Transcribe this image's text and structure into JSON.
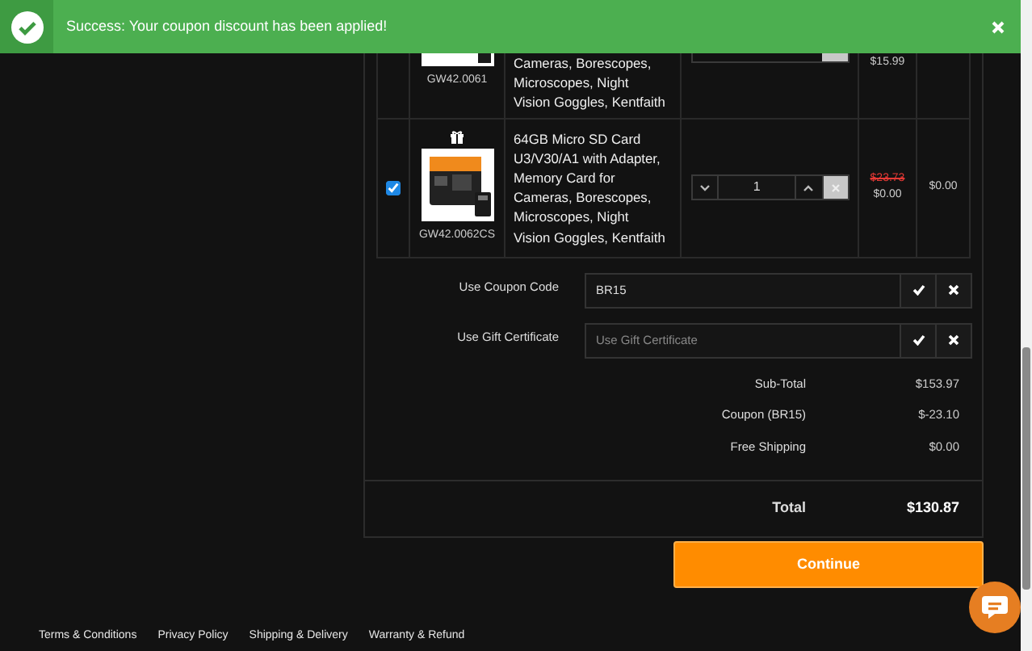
{
  "alert": {
    "message": "Success: Your coupon discount has been applied!"
  },
  "cart": {
    "rows": [
      {
        "kind": "partial",
        "code": "GW42.0061",
        "description": "Cameras, Borescopes, Microscopes, Night Vision Goggles, Kentfaith",
        "price": "$15.99"
      },
      {
        "kind": "full",
        "selected": true,
        "gift": true,
        "code": "GW42.0062CS",
        "description": "64GB Micro SD Card U3/V30/A1 with Adapter, Memory Card for Cameras, Borescopes, Microscopes, Night Vision Goggles, Kentfaith",
        "quantity": "1",
        "old_price": "$23.73",
        "price": "$0.00",
        "total": "$0.00"
      }
    ]
  },
  "codes": [
    {
      "label": "Use Coupon Code",
      "value": "BR15"
    },
    {
      "label": "Use Gift Certificate",
      "placeholder": "Use Gift Certificate"
    }
  ],
  "totals": [
    {
      "label": "Sub-Total",
      "value": "$153.97"
    },
    {
      "label": "Coupon (BR15)",
      "value": "$-23.10"
    },
    {
      "label": "Free Shipping",
      "value": "$0.00"
    }
  ],
  "grand_total": {
    "label": "Total",
    "value": "$130.87"
  },
  "continue_button": "Continue",
  "footer_links": [
    "Terms & Conditions",
    "Privacy Policy",
    "Shipping & Delivery",
    "Warranty & Refund"
  ]
}
